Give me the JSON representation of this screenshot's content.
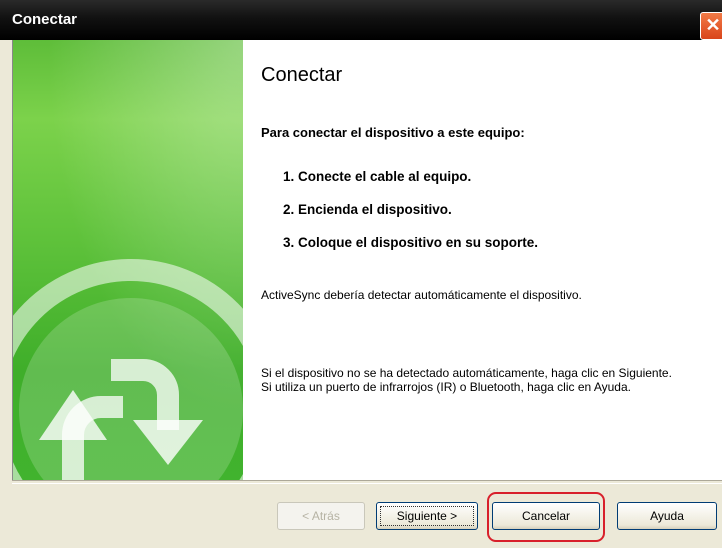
{
  "window": {
    "title": "Conectar",
    "close_label": "✕"
  },
  "content": {
    "heading": "Conectar",
    "intro": "Para conectar el dispositivo a este equipo:",
    "steps": [
      "1. Conecte el cable al equipo.",
      "2. Encienda el dispositivo.",
      "3. Coloque el dispositivo en su soporte."
    ],
    "para1": "ActiveSync debería detectar automáticamente el dispositivo.",
    "para2_line1": "Si el dispositivo no se ha detectado automáticamente, haga clic en Siguiente.",
    "para2_line2": "Si utiliza un puerto de infrarrojos (IR) o Bluetooth, haga clic en Ayuda."
  },
  "buttons": {
    "back": "< Atrás",
    "next": "Siguiente >",
    "cancel": "Cancelar",
    "help": "Ayuda"
  },
  "banner": {
    "icon": "sync-arrows-icon"
  }
}
